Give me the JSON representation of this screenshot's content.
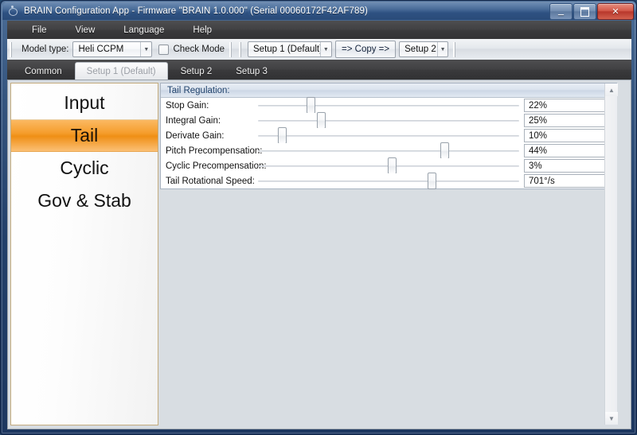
{
  "window": {
    "title": "BRAIN Configuration App - Firmware \"BRAIN 1.0.000\" (Serial 00060172F42AF789)",
    "controls": {
      "minimize": "–",
      "maximize": "□",
      "close": "✕"
    }
  },
  "menubar": {
    "items": [
      {
        "label": "File"
      },
      {
        "label": "View"
      },
      {
        "label": "Language"
      },
      {
        "label": "Help"
      }
    ]
  },
  "toolbar": {
    "model_type_label": "Model type:",
    "model_type_value": "Heli CCPM",
    "check_mode_label": "Check Mode",
    "check_mode_checked": false,
    "setup_source_value": "Setup 1 (Default)",
    "copy_label": "=> Copy =>",
    "setup_target_value": "Setup 2",
    "dropdown_arrow": "▼"
  },
  "tabs": {
    "items": [
      {
        "label": "Common",
        "selected": false
      },
      {
        "label": "Setup 1 (Default)",
        "selected": true
      },
      {
        "label": "Setup 2",
        "selected": false
      },
      {
        "label": "Setup 3",
        "selected": false
      }
    ]
  },
  "sidebar": {
    "items": [
      {
        "label": "Input",
        "selected": false
      },
      {
        "label": "Tail",
        "selected": true
      },
      {
        "label": "Cyclic",
        "selected": false
      },
      {
        "label": "Gov & Stab",
        "selected": false
      }
    ]
  },
  "main": {
    "group_title": "Tail Regulation:",
    "sliders": [
      {
        "label": "Stop Gain:",
        "value": "22%",
        "percent": 20
      },
      {
        "label": "Integral Gain:",
        "value": "25%",
        "percent": 24
      },
      {
        "label": "Derivate Gain:",
        "value": "10%",
        "percent": 9
      },
      {
        "label": "Pitch Precompensation:",
        "value": "44%",
        "percent": 71
      },
      {
        "label": "Cyclic Precompensation:",
        "value": "3%",
        "percent": 51
      },
      {
        "label": "Tail Rotational Speed:",
        "value": "701°/s",
        "percent": 66
      }
    ]
  },
  "scrollbar": {
    "up_arrow": "▲",
    "down_arrow": "▼"
  },
  "colors": {
    "accent_orange": "#f59d2c",
    "titlebar_blue": "#2e5182",
    "close_red": "#b8372b",
    "group_header_text": "#23456e"
  }
}
